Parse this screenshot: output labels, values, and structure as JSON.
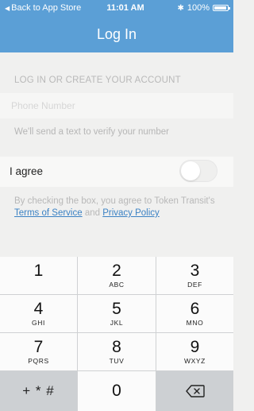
{
  "status_bar": {
    "back_label": "Back to App Store",
    "time": "11:01 AM",
    "battery": "100%"
  },
  "nav": {
    "title": "Log In"
  },
  "form": {
    "section_header": "LOG IN OR CREATE YOUR ACCOUNT",
    "phone_placeholder": "Phone Number",
    "phone_value": "",
    "helper": "We'll send a text to verify your number",
    "agree_label": "I agree",
    "agree_on": false,
    "terms_prefix": "By checking the box, you agree to Token Transit's ",
    "terms_link": "Terms of Service",
    "terms_and": " and ",
    "privacy_link": "Privacy Policy"
  },
  "keypad": {
    "keys": [
      {
        "digit": "1",
        "letters": ""
      },
      {
        "digit": "2",
        "letters": "ABC"
      },
      {
        "digit": "3",
        "letters": "DEF"
      },
      {
        "digit": "4",
        "letters": "GHI"
      },
      {
        "digit": "5",
        "letters": "JKL"
      },
      {
        "digit": "6",
        "letters": "MNO"
      },
      {
        "digit": "7",
        "letters": "PQRS"
      },
      {
        "digit": "8",
        "letters": "TUV"
      },
      {
        "digit": "9",
        "letters": "WXYZ"
      }
    ],
    "symbols": "+ * #",
    "zero": "0"
  },
  "icons": {
    "back": "back-arrow-icon",
    "bluetooth": "bluetooth-icon",
    "battery": "battery-icon",
    "delete": "backspace-icon"
  },
  "colors": {
    "nav_blue": "#5b9fd6",
    "link_blue": "#3b82c4"
  }
}
